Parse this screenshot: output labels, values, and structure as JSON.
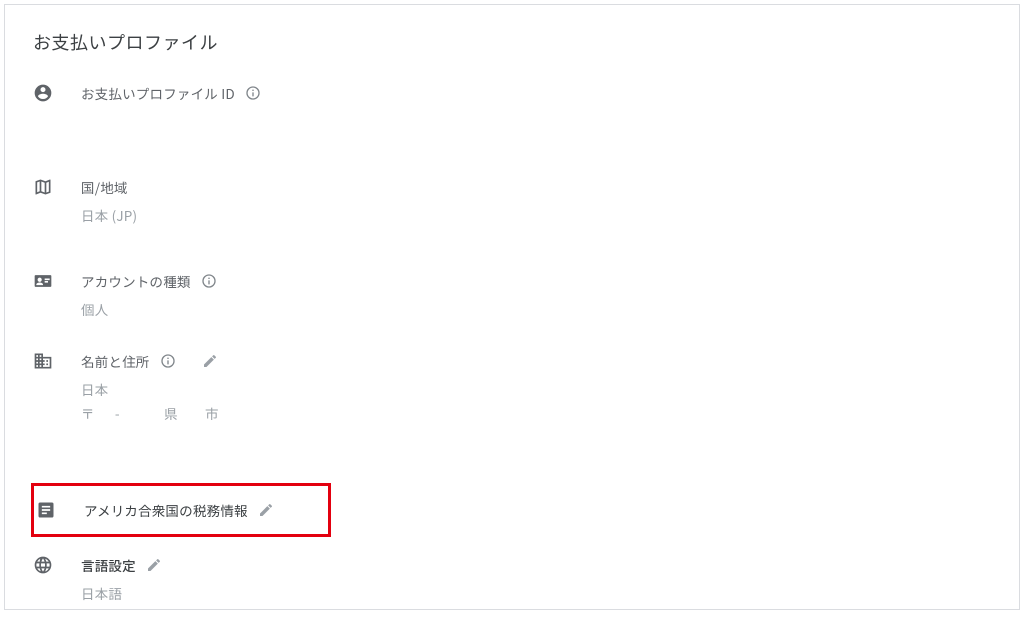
{
  "title": "お支払いプロファイル",
  "sections": {
    "profile_id": {
      "label": "お支払いプロファイル ID"
    },
    "country": {
      "label": "国/地域",
      "value": "日本 (JP)"
    },
    "account_type": {
      "label": "アカウントの種類",
      "value": "個人"
    },
    "name_address": {
      "label": "名前と住所",
      "value_line1": "日本",
      "value_line2": "〒 　 - 　　　県　　市"
    },
    "us_tax": {
      "label": "アメリカ合衆国の税務情報"
    },
    "language": {
      "label": "言語設定",
      "value": "日本語"
    }
  }
}
